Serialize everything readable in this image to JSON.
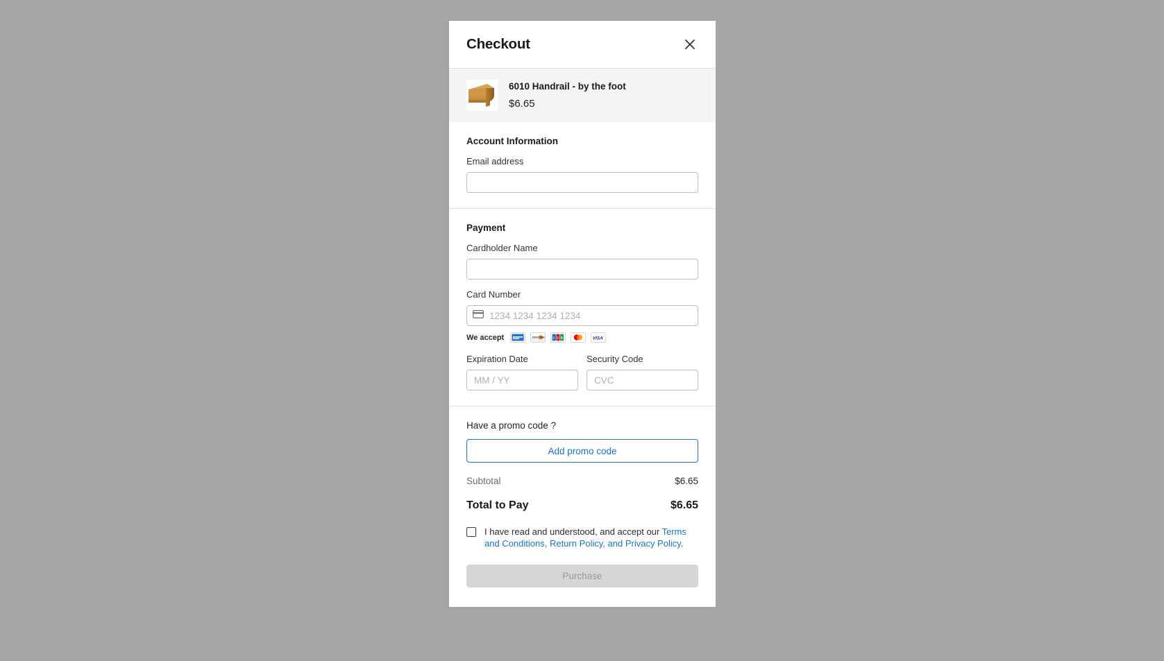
{
  "modal": {
    "title": "Checkout",
    "close_icon": "close-icon"
  },
  "product": {
    "name": "6010 Handrail - by the foot",
    "price": "$6.65",
    "image_alt": "wood-handrail-profile"
  },
  "account": {
    "section_title": "Account Information",
    "email_label": "Email address",
    "email_value": "",
    "email_placeholder": ""
  },
  "payment": {
    "section_title": "Payment",
    "cardholder_label": "Cardholder Name",
    "cardholder_value": "",
    "cardholder_placeholder": "",
    "card_number_label": "Card Number",
    "card_number_value": "",
    "card_number_placeholder": "1234 1234 1234 1234",
    "card_icon": "credit-card-icon",
    "we_accept_label": "We accept",
    "accepted_brands": [
      {
        "name": "amex",
        "label": "AMEX"
      },
      {
        "name": "discover",
        "label": "DISCOVER"
      },
      {
        "name": "jcb",
        "label": "JCB"
      },
      {
        "name": "mastercard",
        "label": "Mastercard"
      },
      {
        "name": "visa",
        "label": "VISA"
      }
    ],
    "expiration_label": "Expiration Date",
    "expiration_value": "",
    "expiration_placeholder": "MM / YY",
    "security_label": "Security Code",
    "security_value": "",
    "security_placeholder": "CVC"
  },
  "promo": {
    "prompt": "Have a promo code ?",
    "button_label": "Add promo code"
  },
  "totals": {
    "subtotal_label": "Subtotal",
    "subtotal_value": "$6.65",
    "total_label": "Total to Pay",
    "total_value": "$6.65"
  },
  "terms": {
    "checked": false,
    "lead_text": "I have read and understood, and accept our ",
    "link_text": "Terms and Conditions, Return Policy, and Privacy Policy",
    "trail_text": "."
  },
  "purchase": {
    "label": "Purchase",
    "disabled": true
  },
  "colors": {
    "accent_blue": "#1a73c8",
    "overlay": "#a5a5a5",
    "product_row_bg": "#f4f4f4",
    "disabled_button": "#d6d6d6"
  }
}
